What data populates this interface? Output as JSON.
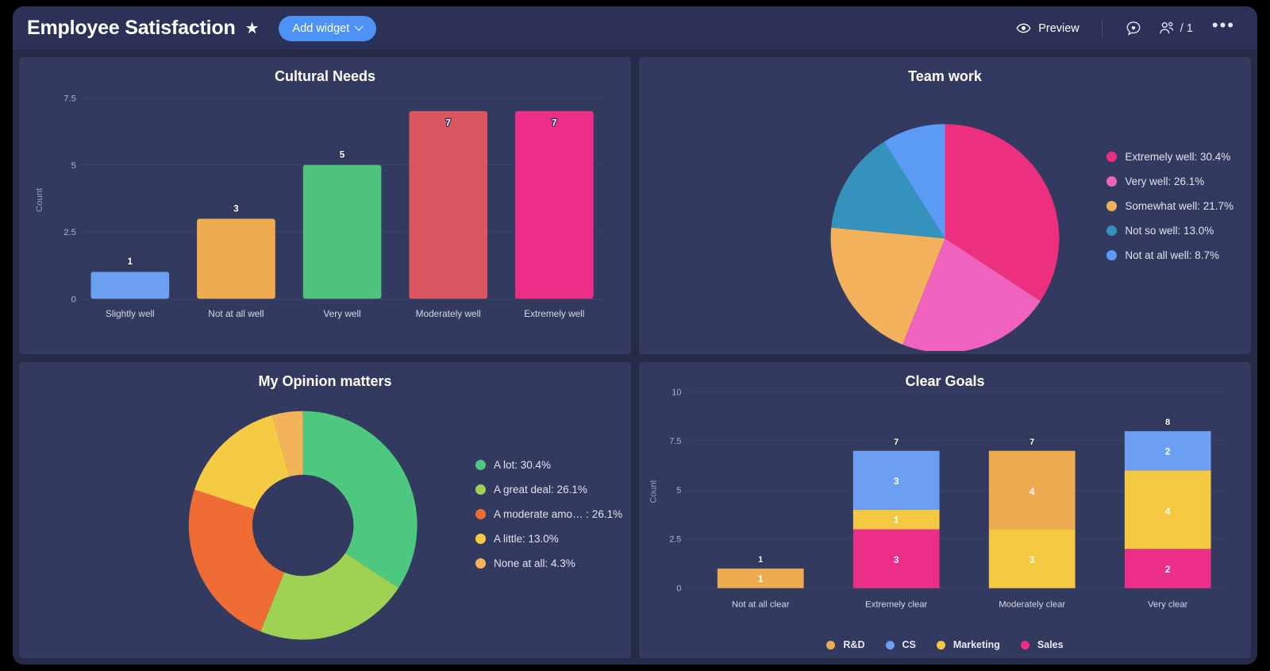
{
  "header": {
    "title": "Employee Satisfaction",
    "star_icon": "star-icon",
    "add_widget_label": "Add widget",
    "preview_label": "Preview",
    "eye_icon": "eye-icon",
    "chat_icon": "chat-bubble-heart-icon",
    "people_icon": "people-icon",
    "people_count": "/ 1",
    "more_icon": "•••"
  },
  "colors": {
    "accent_blue": "#4d93f6",
    "page_bg": "#252b47",
    "header_bg": "#2b3157",
    "card_bg": "#333a60",
    "bar_blue": "#6a9ff2",
    "bar_orange": "#eeab4f",
    "bar_green": "#4fc37b",
    "bar_red": "#da5560",
    "bar_pink": "#ec2f86",
    "pie_pink": "#ec2f7e",
    "pie_magenta": "#ef62bd",
    "pie_orange": "#f2b15a",
    "pie_teal": "#3492bd",
    "pie_blue": "#5b9bf5",
    "donut_green": "#4ec77f",
    "donut_lime": "#9ed252",
    "donut_orange_red": "#ef6c34",
    "donut_yellow": "#f5cb43",
    "donut_light_orange": "#f3b35a",
    "stack_rd": "#eeab4f",
    "stack_cs": "#6a9ff2",
    "stack_marketing": "#f5c842",
    "stack_sales": "#ec2f86"
  },
  "widgets": [
    {
      "id": "cultural-needs",
      "title": "Cultural Needs"
    },
    {
      "id": "team-work",
      "title": "Team work"
    },
    {
      "id": "my-opinion-matters",
      "title": "My Opinion matters"
    },
    {
      "id": "clear-goals",
      "title": "Clear Goals"
    }
  ],
  "chart_data": [
    {
      "id": "cultural-needs",
      "type": "bar",
      "title": "Cultural Needs",
      "xlabel": "",
      "ylabel": "Count",
      "ylim": [
        0,
        7.5
      ],
      "yticks": [
        "0",
        "2.5",
        "5",
        "7.5"
      ],
      "ytick_values": [
        0,
        2.5,
        5,
        7.5
      ],
      "grid": true,
      "categories": [
        "Slightly well",
        "Not at all well",
        "Very well",
        "Moderately well",
        "Extremely well"
      ],
      "values": [
        1,
        3,
        5,
        7,
        7
      ],
      "colors": [
        "#6a9ff2",
        "#eeab4f",
        "#4fc37b",
        "#da5560",
        "#ec2f86"
      ],
      "labels": [
        "1",
        "3",
        "5",
        "7",
        "7"
      ]
    },
    {
      "id": "team-work",
      "type": "pie",
      "title": "Team work",
      "legend_position": "right",
      "slices": [
        {
          "label": "Extremely well",
          "percent": 30.4,
          "legend": "Extremely well: 30.4%",
          "color": "#ec2f7e"
        },
        {
          "label": "Very well",
          "percent": 26.1,
          "legend": "Very well: 26.1%",
          "color": "#ef62bd"
        },
        {
          "label": "Somewhat well",
          "percent": 21.7,
          "legend": "Somewhat well: 21.7%",
          "color": "#f2b15a"
        },
        {
          "label": "Not so well",
          "percent": 13.0,
          "legend": "Not so well: 13.0%",
          "color": "#3492bd"
        },
        {
          "label": "Not at all well",
          "percent": 8.7,
          "legend": "Not at all well: 8.7%",
          "color": "#5b9bf5"
        }
      ]
    },
    {
      "id": "my-opinion-matters",
      "type": "pie",
      "variant": "donut",
      "title": "My Opinion matters",
      "legend_position": "right",
      "slices": [
        {
          "label": "A lot",
          "percent": 30.4,
          "legend": "A lot: 30.4%",
          "color": "#4ec77f"
        },
        {
          "label": "A great deal",
          "percent": 26.1,
          "legend": "A great deal: 26.1%",
          "color": "#9ed252"
        },
        {
          "label": "A moderate amo…",
          "percent": 26.1,
          "legend": "A moderate amo…  : 26.1%",
          "color": "#ef6c34"
        },
        {
          "label": "A little",
          "percent": 13.0,
          "legend": "A little: 13.0%",
          "color": "#f5cb43"
        },
        {
          "label": "None at all",
          "percent": 4.3,
          "legend": "None at all: 4.3%",
          "color": "#f3b35a"
        }
      ]
    },
    {
      "id": "clear-goals",
      "type": "bar",
      "variant": "stacked",
      "title": "Clear Goals",
      "xlabel": "",
      "ylabel": "Count",
      "ylim": [
        0,
        10
      ],
      "yticks": [
        "0",
        "2.5",
        "5",
        "7.5",
        "10"
      ],
      "ytick_values": [
        0,
        2.5,
        5,
        7.5,
        10
      ],
      "grid": true,
      "categories": [
        "Not at all clear",
        "Extremely clear",
        "Moderately clear",
        "Very clear"
      ],
      "totals": [
        1,
        7,
        7,
        8
      ],
      "total_labels": [
        "1",
        "7",
        "7",
        "8"
      ],
      "legend_position": "bottom",
      "series": [
        {
          "name": "Sales",
          "color": "#ec2f86",
          "values": [
            0,
            3,
            0,
            2
          ]
        },
        {
          "name": "Marketing",
          "color": "#f5c842",
          "values": [
            0,
            1,
            3,
            4
          ]
        },
        {
          "name": "R&D",
          "color": "#eeab4f",
          "values": [
            1,
            0,
            4,
            0
          ]
        },
        {
          "name": "CS",
          "color": "#6a9ff2",
          "values": [
            0,
            3,
            0,
            2
          ]
        }
      ],
      "legend_order": [
        "R&D",
        "CS",
        "Marketing",
        "Sales"
      ]
    }
  ]
}
